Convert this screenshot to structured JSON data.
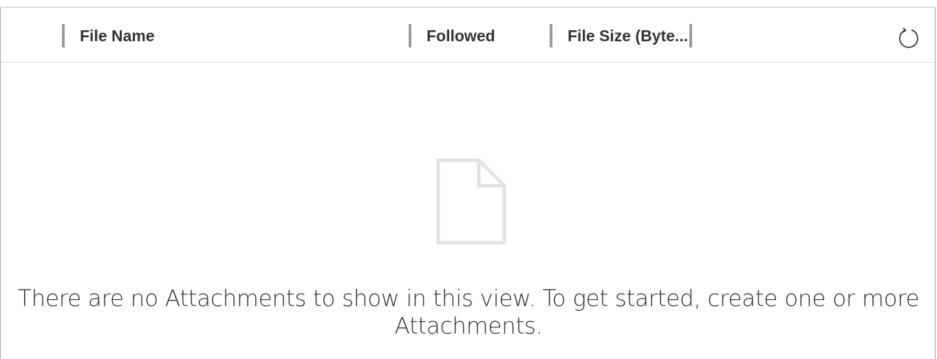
{
  "grid": {
    "columns": [
      {
        "label": "File Name"
      },
      {
        "label": "Followed"
      },
      {
        "label": "File Size (Byte..."
      }
    ],
    "refresh_icon": "refresh-icon"
  },
  "empty_state": {
    "icon": "document-icon",
    "message": "There are no Attachments to show in this view. To get started, create one or more Attachments."
  }
}
